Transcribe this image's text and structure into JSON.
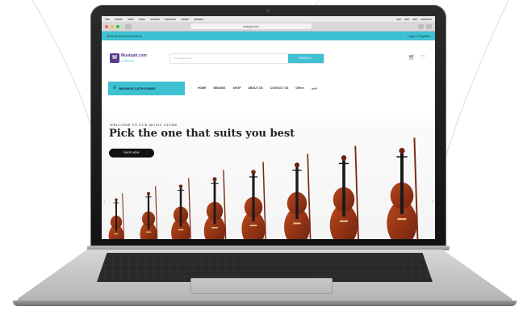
{
  "browser": {
    "url": "musiqati.com"
  },
  "topbar": {
    "left_text": "Musical Instrument Store",
    "right_text": "Login / Register"
  },
  "header": {
    "logo_mark": "M",
    "logo_text": "Musiqati.com",
    "logo_sub": "موسيقاتي",
    "search_placeholder": "I'm shopping for...",
    "search_button": "SEARCH",
    "cart_icon": "cart-icon",
    "heart_icon": "heart-icon"
  },
  "nav": {
    "browse_label": "BROWSE CATEGORIES",
    "items": [
      "HOME",
      "BRANDS",
      "SHOP",
      "ABOUT US",
      "CONTACT US",
      "Offers",
      "عربي"
    ]
  },
  "hero": {
    "kicker": "WELCOME TO OUR MUSIC STORE",
    "title": "Pick the one that suits you best",
    "cta": "SHOP NOW"
  },
  "colors": {
    "accent": "#3ec1d3",
    "brand": "#5a3b8c",
    "violin": "#8a2f14"
  }
}
